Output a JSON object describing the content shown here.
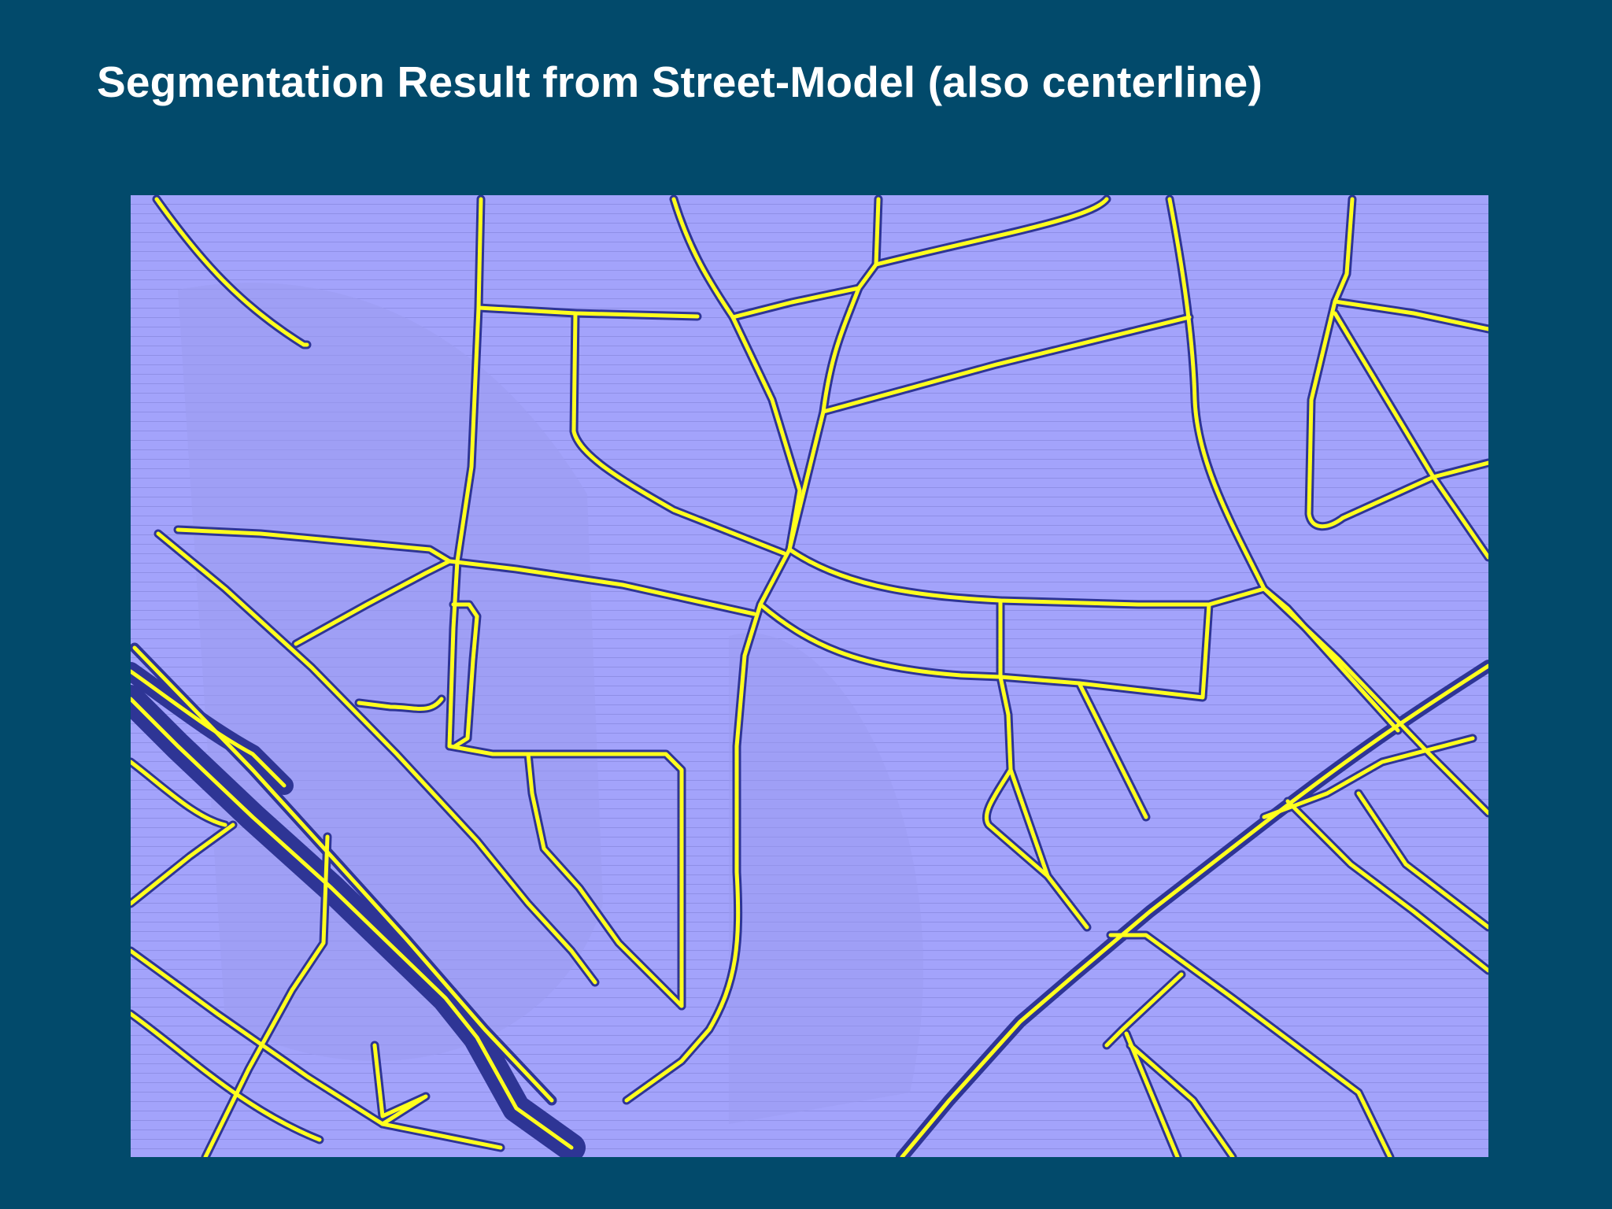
{
  "slide": {
    "title": "Segmentation Result from Street-Model (also centerline)"
  },
  "colors": {
    "background": "#024a6b",
    "map_fill": "#a3a3fb",
    "road_casing": "#2e3595",
    "centerline": "#ffff1e",
    "title_text": "#ffffff"
  },
  "map": {
    "description_icon": "segmented-street-map-image"
  }
}
